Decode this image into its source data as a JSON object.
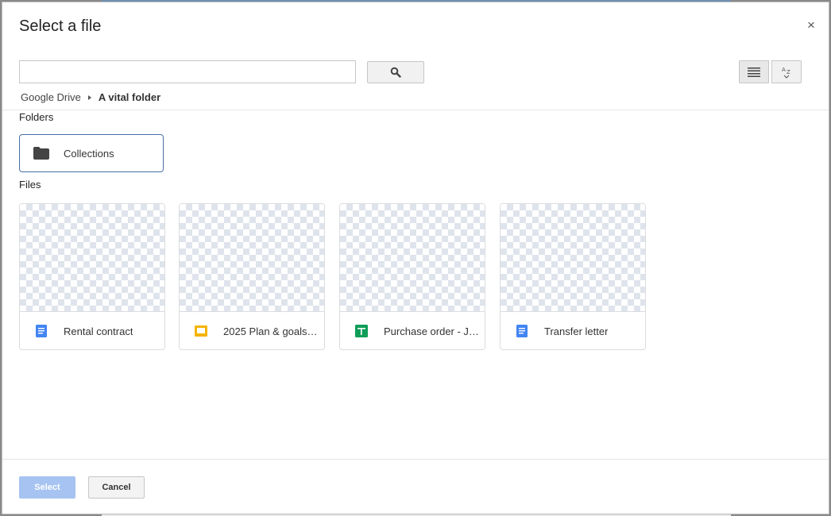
{
  "dialog": {
    "title": "Select a file",
    "close_label": "×"
  },
  "search": {
    "value": "",
    "placeholder": ""
  },
  "icons": {
    "search": "search-icon",
    "list_view": "list-view-icon",
    "sort": "sort-az-icon",
    "folder": "folder-icon"
  },
  "breadcrumb": {
    "root": "Google Drive",
    "current": "A vital folder"
  },
  "sections": {
    "folders": "Folders",
    "files": "Files"
  },
  "folders": [
    {
      "name": "Collections"
    }
  ],
  "files": [
    {
      "name": "Rental contract",
      "type": "doc",
      "color": "#4285f4"
    },
    {
      "name": "2025 Plan & goals…",
      "type": "slides",
      "color": "#f4b400"
    },
    {
      "name": "Purchase order - J…",
      "type": "sheet",
      "color": "#0f9d58"
    },
    {
      "name": "Transfer letter",
      "type": "doc",
      "color": "#4285f4"
    }
  ],
  "footer": {
    "select_label": "Select",
    "cancel_label": "Cancel"
  },
  "colors": {
    "select_button": "#a6c3f2",
    "folder_border": "#4a6fa5"
  }
}
